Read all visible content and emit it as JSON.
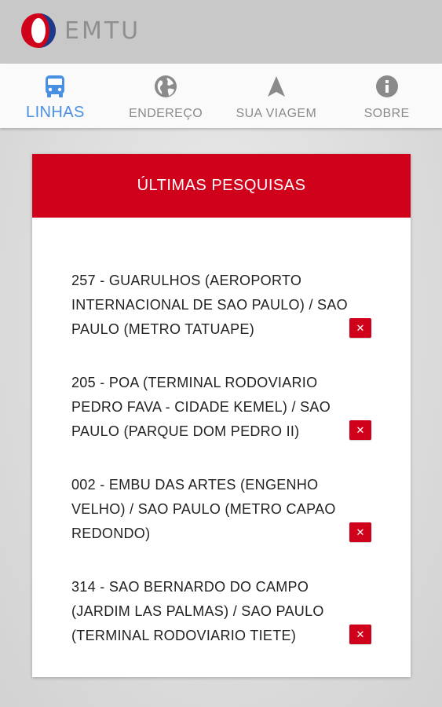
{
  "header": {
    "app_name": "EMTU"
  },
  "tabs": [
    {
      "label": "LINHAS",
      "icon": "bus-icon",
      "active": true
    },
    {
      "label": "ENDEREÇO",
      "icon": "globe-icon",
      "active": false
    },
    {
      "label": "SUA VIAGEM",
      "icon": "navigation-arrow-icon",
      "active": false
    },
    {
      "label": "SOBRE",
      "icon": "info-icon",
      "active": false
    }
  ],
  "card": {
    "title": "ÚLTIMAS PESQUISAS",
    "items": [
      {
        "text": "257 - GUARULHOS (AEROPORTO INTERNACIONAL DE SAO PAULO) / SAO PAULO (METRO TATUAPE)",
        "delete_label": "✕"
      },
      {
        "text": "205 - POA (TERMINAL RODOVIARIO PEDRO FAVA - CIDADE KEMEL) / SAO PAULO (PARQUE DOM PEDRO II)",
        "delete_label": "✕"
      },
      {
        "text": "002 - EMBU DAS ARTES (ENGENHO VELHO) / SAO PAULO (METRO CAPAO REDONDO)",
        "delete_label": "✕"
      },
      {
        "text": "314 - SAO BERNARDO DO CAMPO (JARDIM LAS PALMAS) / SAO PAULO (TERMINAL RODOVIARIO TIETE)",
        "delete_label": "✕"
      }
    ]
  },
  "colors": {
    "accent": "#4a90e2",
    "brand_red": "#d0021b",
    "inactive": "#8a8a8a"
  }
}
